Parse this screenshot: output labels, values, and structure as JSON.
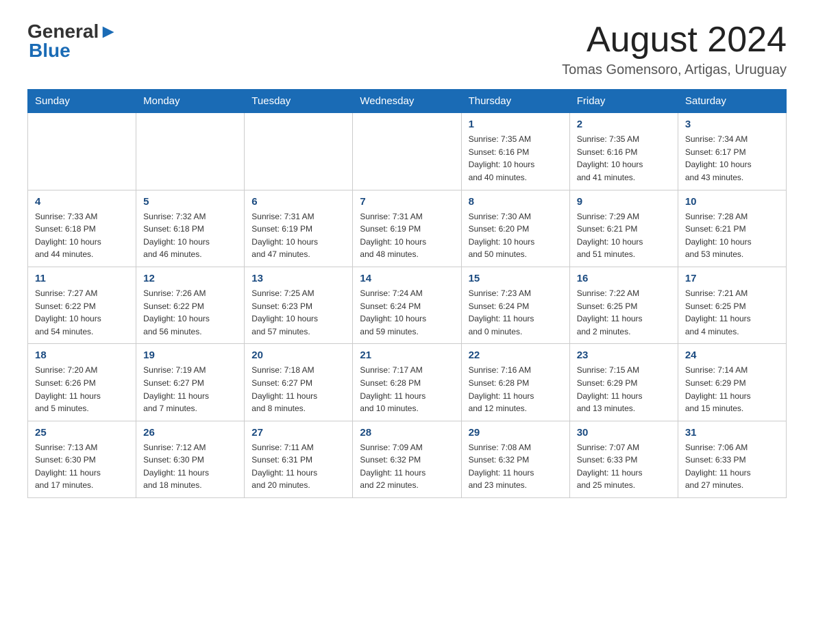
{
  "header": {
    "logo": {
      "general": "General",
      "blue": "Blue"
    },
    "title": "August 2024",
    "location": "Tomas Gomensoro, Artigas, Uruguay"
  },
  "weekdays": [
    "Sunday",
    "Monday",
    "Tuesday",
    "Wednesday",
    "Thursday",
    "Friday",
    "Saturday"
  ],
  "weeks": [
    [
      {
        "day": "",
        "info": ""
      },
      {
        "day": "",
        "info": ""
      },
      {
        "day": "",
        "info": ""
      },
      {
        "day": "",
        "info": ""
      },
      {
        "day": "1",
        "info": "Sunrise: 7:35 AM\nSunset: 6:16 PM\nDaylight: 10 hours\nand 40 minutes."
      },
      {
        "day": "2",
        "info": "Sunrise: 7:35 AM\nSunset: 6:16 PM\nDaylight: 10 hours\nand 41 minutes."
      },
      {
        "day": "3",
        "info": "Sunrise: 7:34 AM\nSunset: 6:17 PM\nDaylight: 10 hours\nand 43 minutes."
      }
    ],
    [
      {
        "day": "4",
        "info": "Sunrise: 7:33 AM\nSunset: 6:18 PM\nDaylight: 10 hours\nand 44 minutes."
      },
      {
        "day": "5",
        "info": "Sunrise: 7:32 AM\nSunset: 6:18 PM\nDaylight: 10 hours\nand 46 minutes."
      },
      {
        "day": "6",
        "info": "Sunrise: 7:31 AM\nSunset: 6:19 PM\nDaylight: 10 hours\nand 47 minutes."
      },
      {
        "day": "7",
        "info": "Sunrise: 7:31 AM\nSunset: 6:19 PM\nDaylight: 10 hours\nand 48 minutes."
      },
      {
        "day": "8",
        "info": "Sunrise: 7:30 AM\nSunset: 6:20 PM\nDaylight: 10 hours\nand 50 minutes."
      },
      {
        "day": "9",
        "info": "Sunrise: 7:29 AM\nSunset: 6:21 PM\nDaylight: 10 hours\nand 51 minutes."
      },
      {
        "day": "10",
        "info": "Sunrise: 7:28 AM\nSunset: 6:21 PM\nDaylight: 10 hours\nand 53 minutes."
      }
    ],
    [
      {
        "day": "11",
        "info": "Sunrise: 7:27 AM\nSunset: 6:22 PM\nDaylight: 10 hours\nand 54 minutes."
      },
      {
        "day": "12",
        "info": "Sunrise: 7:26 AM\nSunset: 6:22 PM\nDaylight: 10 hours\nand 56 minutes."
      },
      {
        "day": "13",
        "info": "Sunrise: 7:25 AM\nSunset: 6:23 PM\nDaylight: 10 hours\nand 57 minutes."
      },
      {
        "day": "14",
        "info": "Sunrise: 7:24 AM\nSunset: 6:24 PM\nDaylight: 10 hours\nand 59 minutes."
      },
      {
        "day": "15",
        "info": "Sunrise: 7:23 AM\nSunset: 6:24 PM\nDaylight: 11 hours\nand 0 minutes."
      },
      {
        "day": "16",
        "info": "Sunrise: 7:22 AM\nSunset: 6:25 PM\nDaylight: 11 hours\nand 2 minutes."
      },
      {
        "day": "17",
        "info": "Sunrise: 7:21 AM\nSunset: 6:25 PM\nDaylight: 11 hours\nand 4 minutes."
      }
    ],
    [
      {
        "day": "18",
        "info": "Sunrise: 7:20 AM\nSunset: 6:26 PM\nDaylight: 11 hours\nand 5 minutes."
      },
      {
        "day": "19",
        "info": "Sunrise: 7:19 AM\nSunset: 6:27 PM\nDaylight: 11 hours\nand 7 minutes."
      },
      {
        "day": "20",
        "info": "Sunrise: 7:18 AM\nSunset: 6:27 PM\nDaylight: 11 hours\nand 8 minutes."
      },
      {
        "day": "21",
        "info": "Sunrise: 7:17 AM\nSunset: 6:28 PM\nDaylight: 11 hours\nand 10 minutes."
      },
      {
        "day": "22",
        "info": "Sunrise: 7:16 AM\nSunset: 6:28 PM\nDaylight: 11 hours\nand 12 minutes."
      },
      {
        "day": "23",
        "info": "Sunrise: 7:15 AM\nSunset: 6:29 PM\nDaylight: 11 hours\nand 13 minutes."
      },
      {
        "day": "24",
        "info": "Sunrise: 7:14 AM\nSunset: 6:29 PM\nDaylight: 11 hours\nand 15 minutes."
      }
    ],
    [
      {
        "day": "25",
        "info": "Sunrise: 7:13 AM\nSunset: 6:30 PM\nDaylight: 11 hours\nand 17 minutes."
      },
      {
        "day": "26",
        "info": "Sunrise: 7:12 AM\nSunset: 6:30 PM\nDaylight: 11 hours\nand 18 minutes."
      },
      {
        "day": "27",
        "info": "Sunrise: 7:11 AM\nSunset: 6:31 PM\nDaylight: 11 hours\nand 20 minutes."
      },
      {
        "day": "28",
        "info": "Sunrise: 7:09 AM\nSunset: 6:32 PM\nDaylight: 11 hours\nand 22 minutes."
      },
      {
        "day": "29",
        "info": "Sunrise: 7:08 AM\nSunset: 6:32 PM\nDaylight: 11 hours\nand 23 minutes."
      },
      {
        "day": "30",
        "info": "Sunrise: 7:07 AM\nSunset: 6:33 PM\nDaylight: 11 hours\nand 25 minutes."
      },
      {
        "day": "31",
        "info": "Sunrise: 7:06 AM\nSunset: 6:33 PM\nDaylight: 11 hours\nand 27 minutes."
      }
    ]
  ]
}
